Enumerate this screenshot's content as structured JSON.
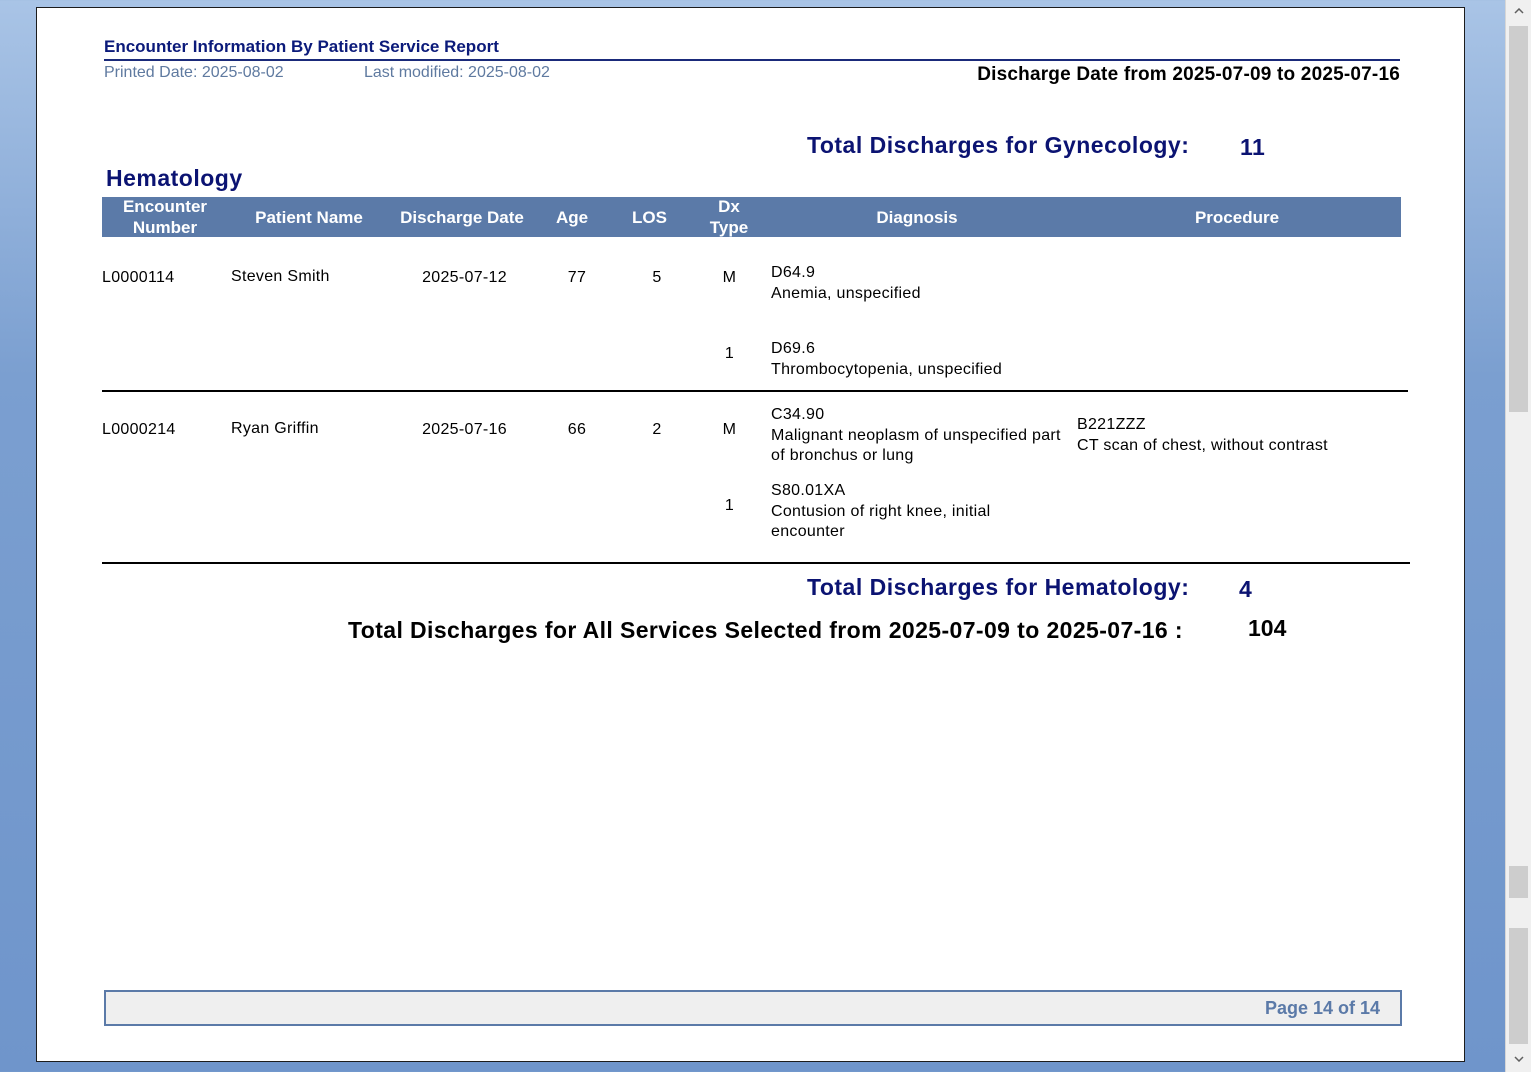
{
  "report": {
    "title": "Encounter Information By Patient Service Report",
    "printed_date": "Printed Date:  2025-08-02",
    "last_modified": "Last modified: 2025-08-02",
    "discharge_range": "Discharge Date from 2025-07-09  to  2025-07-16"
  },
  "previous_total": {
    "label": "Total Discharges for Gynecology:",
    "value": "11"
  },
  "service": {
    "name": "Hematology"
  },
  "columns": {
    "encounter": "Encounter Number",
    "patient": "Patient Name",
    "discharge": "Discharge Date",
    "age": "Age",
    "los": "LOS",
    "dxtype": "Dx Type",
    "diagnosis": "Diagnosis",
    "procedure": "Procedure"
  },
  "rows": [
    {
      "encounter": "L0000114",
      "patient": "Steven Smith",
      "discharge": "2025-07-12",
      "age": "77",
      "los": "5",
      "diagnoses": [
        {
          "type": "M",
          "code": "D64.9",
          "desc": "Anemia, unspecified"
        },
        {
          "type": "1",
          "code": "D69.6",
          "desc": "Thrombocytopenia, unspecified"
        }
      ],
      "procedure": {
        "code": "",
        "desc": ""
      }
    },
    {
      "encounter": "L0000214",
      "patient": "Ryan Griffin",
      "discharge": "2025-07-16",
      "age": "66",
      "los": "2",
      "diagnoses": [
        {
          "type": "M",
          "code": "C34.90",
          "desc": "Malignant neoplasm of unspecified part of bronchus or lung"
        },
        {
          "type": "1",
          "code": "S80.01XA",
          "desc": "Contusion of right knee, initial encounter"
        }
      ],
      "procedure": {
        "code": "B221ZZZ",
        "desc": "CT scan of chest, without contrast"
      }
    }
  ],
  "service_total": {
    "label": "Total Discharges for Hematology:",
    "value": "4"
  },
  "grand_total": {
    "label": "Total Discharges for All Services Selected from 2025-07-09 to 2025-07-16 :",
    "value": "104"
  },
  "footer": {
    "page": "Page 14 of 14"
  },
  "scrollbar": {
    "up_icon": "chevron-up-icon",
    "down_icon": "chevron-down-icon"
  }
}
